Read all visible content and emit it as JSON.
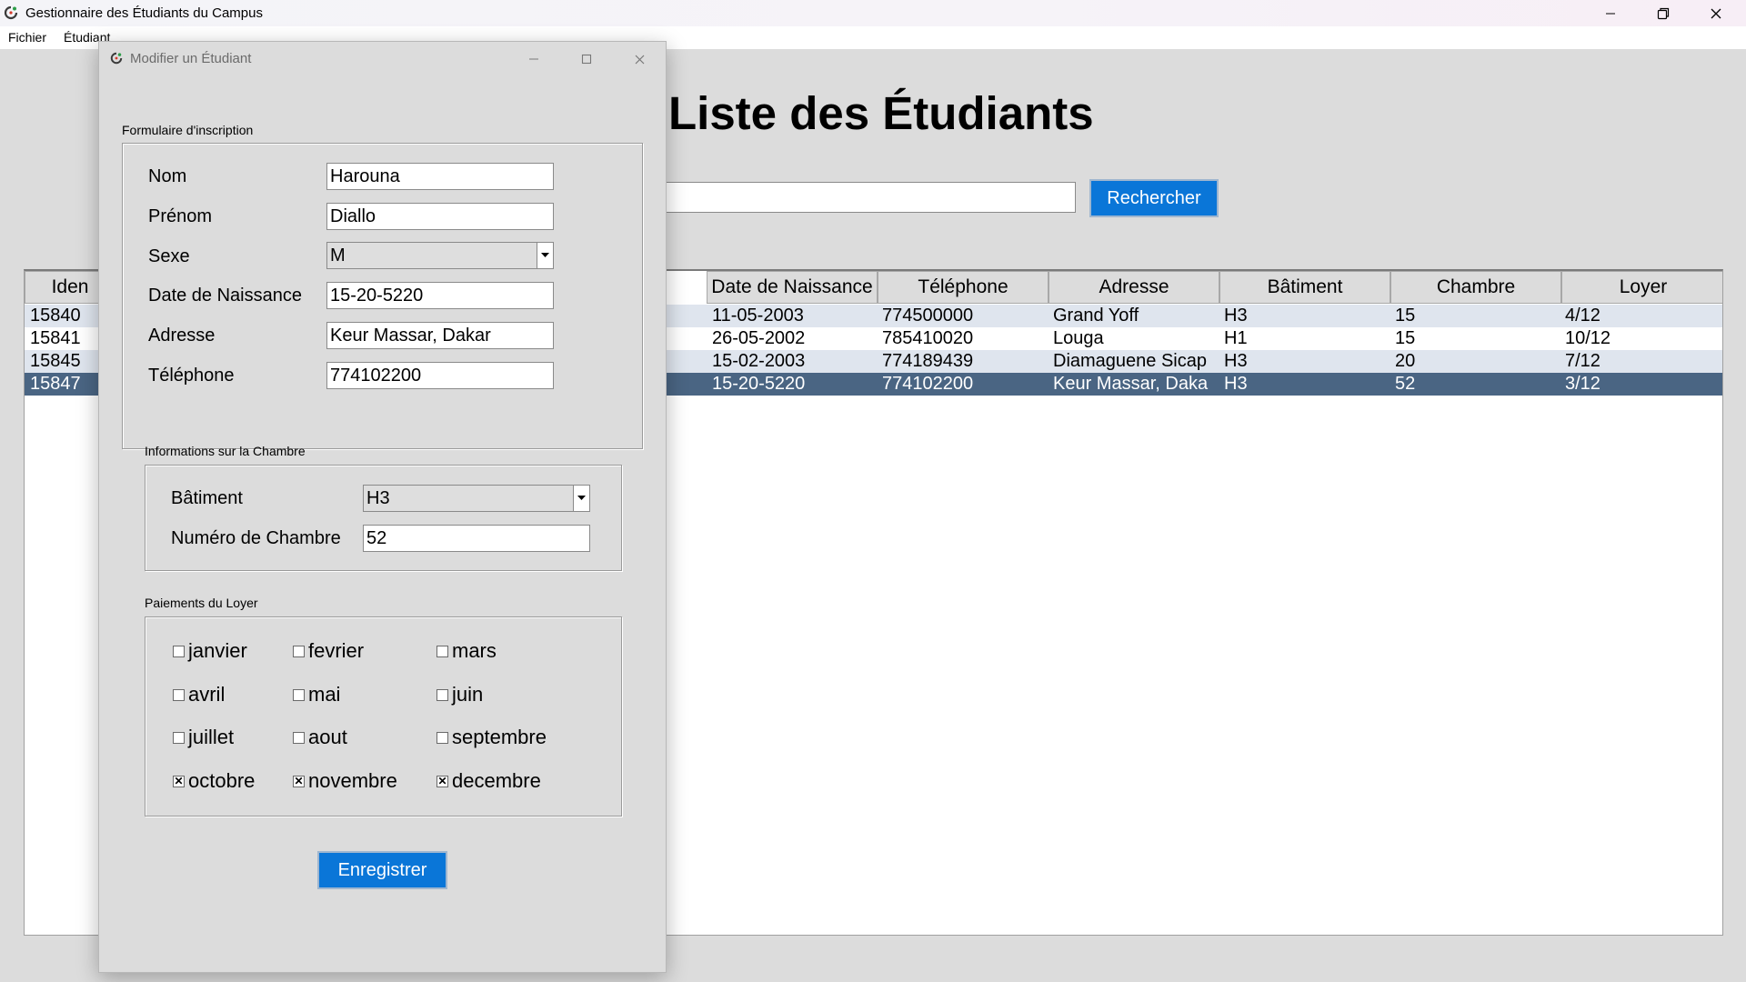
{
  "app": {
    "title": "Gestionnaire des Étudiants du Campus",
    "menu": [
      "Fichier",
      "Étudiant"
    ]
  },
  "main": {
    "heading": "Liste des Étudiants",
    "search": {
      "value": "",
      "button": "Rechercher"
    },
    "table": {
      "columns": [
        "Iden",
        "Date de Naissance",
        "Téléphone",
        "Adresse",
        "Bâtiment",
        "Chambre",
        "Loyer"
      ],
      "rows": [
        [
          "15840",
          "11-05-2003",
          "774500000",
          "Grand Yoff",
          "H3",
          "15",
          "4/12"
        ],
        [
          "15841",
          "26-05-2002",
          "785410020",
          "Louga",
          "H1",
          "15",
          "10/12"
        ],
        [
          "15845",
          "15-02-2003",
          "774189439",
          "Diamaguene Sicap",
          "H3",
          "20",
          "7/12"
        ],
        [
          "15847",
          "15-20-5220",
          "774102200",
          "Keur Massar, Daka",
          "H3",
          "52",
          "3/12"
        ]
      ],
      "selected_row": 3
    }
  },
  "dialog": {
    "title": "Modifier un Étudiant",
    "form_group": "Formulaire d'inscription",
    "fields": {
      "nom": {
        "label": "Nom",
        "value": "Harouna"
      },
      "prenom": {
        "label": "Prénom",
        "value": "Diallo"
      },
      "sexe": {
        "label": "Sexe",
        "value": "M"
      },
      "naissance": {
        "label": "Date de Naissance",
        "value": "15-20-5220"
      },
      "adresse": {
        "label": "Adresse",
        "value": "Keur Massar, Dakar"
      },
      "telephone": {
        "label": "Téléphone",
        "value": "774102200"
      }
    },
    "room_group": "Informations sur la Chambre",
    "room": {
      "batiment": {
        "label": "Bâtiment",
        "value": "H3"
      },
      "chambre": {
        "label": "Numéro de Chambre",
        "value": "52"
      }
    },
    "payments_group": "Paiements du Loyer",
    "months": [
      {
        "label": "janvier",
        "checked": false
      },
      {
        "label": "fevrier",
        "checked": false
      },
      {
        "label": "mars",
        "checked": false
      },
      {
        "label": "avril",
        "checked": false
      },
      {
        "label": "mai",
        "checked": false
      },
      {
        "label": "juin",
        "checked": false
      },
      {
        "label": "juillet",
        "checked": false
      },
      {
        "label": "aout",
        "checked": false
      },
      {
        "label": "septembre",
        "checked": false
      },
      {
        "label": "octobre",
        "checked": true
      },
      {
        "label": "novembre",
        "checked": true
      },
      {
        "label": "decembre",
        "checked": true
      }
    ],
    "save_button": "Enregistrer"
  },
  "icons": {
    "app": "campus-app-icon",
    "minimize": "minimize-icon",
    "maximize": "maximize-icon",
    "restore": "restore-icon",
    "close": "close-icon",
    "dropdown": "chevron-down-icon"
  },
  "colors": {
    "accent_button": "#0a76d8",
    "selected_row": "#4a6583",
    "window_bg": "#dcdcdc"
  }
}
